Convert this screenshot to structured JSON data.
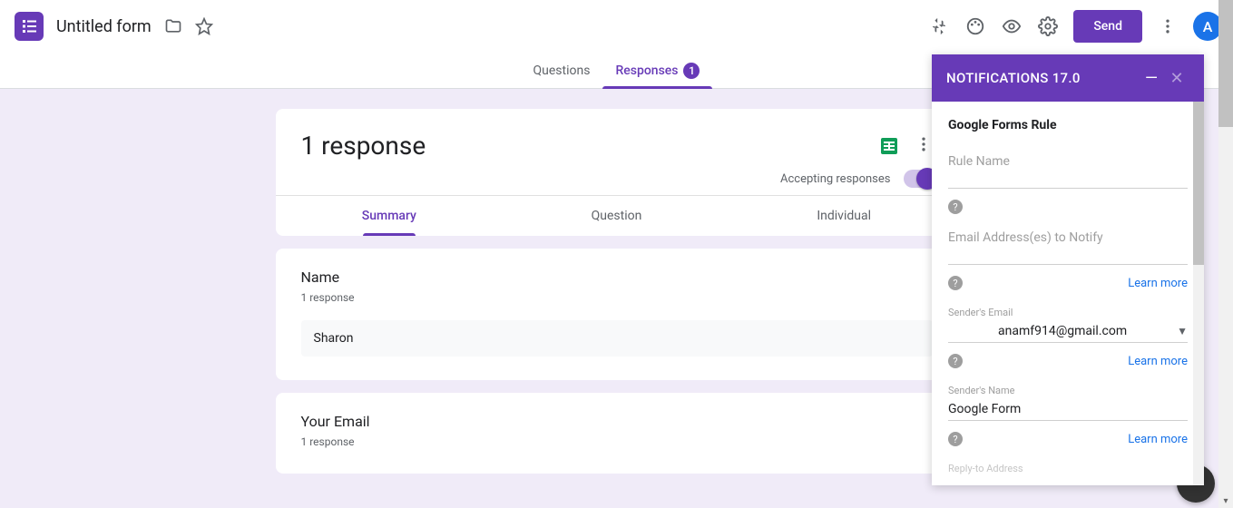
{
  "header": {
    "form_title": "Untitled form",
    "send_label": "Send",
    "avatar_letter": "A"
  },
  "tabs": {
    "questions": "Questions",
    "responses": "Responses",
    "responses_count": "1"
  },
  "responses_card": {
    "title": "1 response",
    "accepting_label": "Accepting responses"
  },
  "subtabs": {
    "summary": "Summary",
    "question": "Question",
    "individual": "Individual"
  },
  "q1": {
    "title": "Name",
    "count": "1 response",
    "answer": "Sharon"
  },
  "q2": {
    "title": "Your Email",
    "count": "1 response"
  },
  "panel": {
    "title": "NOTIFICATIONS 17.0",
    "heading": "Google Forms Rule",
    "rule_name_label": "Rule Name",
    "emails_label": "Email Address(es) to Notify",
    "senders_email_label": "Sender's Email",
    "senders_email_value": "anamf914@gmail.com",
    "senders_name_label": "Sender's Name",
    "senders_name_value": "Google Form",
    "reply_to_label": "Reply-to Address",
    "learn_more": "Learn more"
  }
}
